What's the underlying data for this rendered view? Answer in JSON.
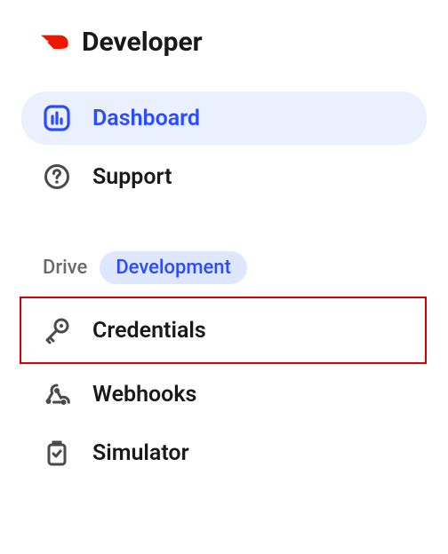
{
  "brand": {
    "name": "Developer"
  },
  "nav": {
    "dashboard": "Dashboard",
    "support": "Support"
  },
  "section": {
    "label": "Drive",
    "env": "Development",
    "credentials": "Credentials",
    "webhooks": "Webhooks",
    "simulator": "Simulator"
  }
}
